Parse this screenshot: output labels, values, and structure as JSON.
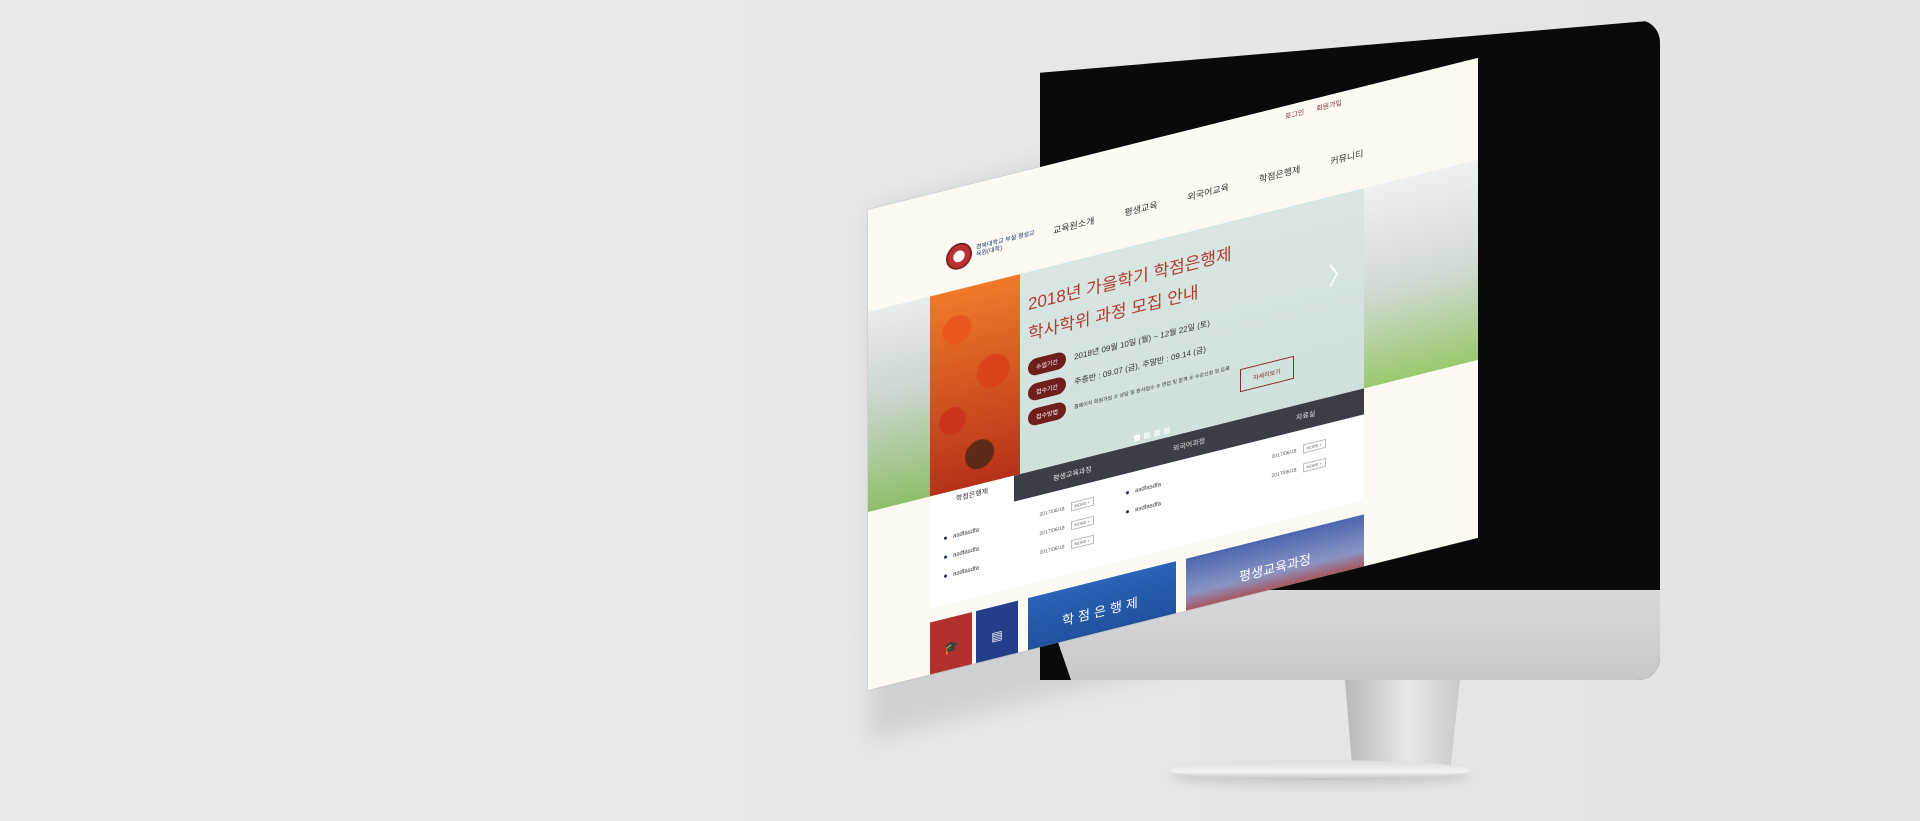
{
  "util": {
    "login": "로그인",
    "join": "회원가입"
  },
  "logo": {
    "text": "경북대학교 부설 평생교육원(대학)"
  },
  "gnb": [
    "교육원소개",
    "평생교육",
    "외국어교육",
    "학점은행제",
    "커뮤니티"
  ],
  "hero": {
    "title_line1": "2018년 가을학기 학점은행제",
    "title_line2": "학사학위 과정 모집 안내",
    "rows": [
      {
        "pill": "수업기간",
        "text": "2018년 09월 10일 (월) ~ 12월 22일 (토)"
      },
      {
        "pill": "접수기간",
        "text": "주중반 : 09.07 (금), 주말반 : 09.14 (금)"
      },
      {
        "pill": "접수방법",
        "text": "홈페이지 회원가입 ② 상담 및 원서접수 ③ 면접 및 합격 ④ 수강신청 및 등록"
      }
    ],
    "more": "자세히보기",
    "arrow": "〉"
  },
  "board": {
    "left_tab": "학점은행제",
    "tabs": [
      "평생교육과정",
      "외국어과정",
      "자료실"
    ],
    "left_list": [
      "asdfasdfa",
      "asdfasdfa",
      "asdfasdfa"
    ],
    "left_dates": [
      "2017/06/18",
      "2017/06/18",
      "2017/06/18"
    ],
    "right_list": [
      "asdfasdfa",
      "asdfasdfa"
    ],
    "right_dates": [
      "2017/06/18",
      "2017/06/18"
    ],
    "more": "MORE +"
  },
  "banners": {
    "credit": "학점은행제",
    "life": "평생교육과정"
  }
}
